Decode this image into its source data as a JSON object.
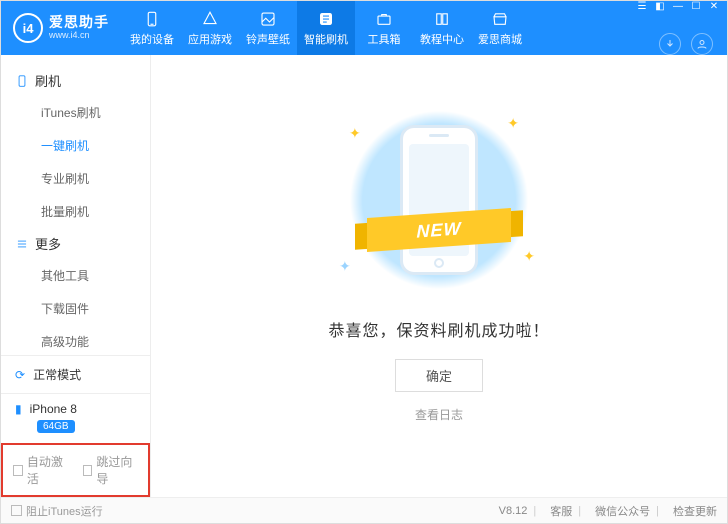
{
  "brand": {
    "logo_text": "i4",
    "title": "爱思助手",
    "url": "www.i4.cn"
  },
  "top_tabs": [
    {
      "label": "我的设备"
    },
    {
      "label": "应用游戏"
    },
    {
      "label": "铃声壁纸"
    },
    {
      "label": "智能刷机"
    },
    {
      "label": "工具箱"
    },
    {
      "label": "教程中心"
    },
    {
      "label": "爱思商城"
    }
  ],
  "sidebar": {
    "sections": [
      {
        "header": "刷机",
        "items": [
          "iTunes刷机",
          "一键刷机",
          "专业刷机",
          "批量刷机"
        ]
      },
      {
        "header": "更多",
        "items": [
          "其他工具",
          "下载固件",
          "高级功能"
        ]
      }
    ],
    "status": "正常模式",
    "device": {
      "name": "iPhone 8",
      "storage": "64GB"
    },
    "options": {
      "auto_activate": "自动激活",
      "skip_guide": "跳过向导"
    }
  },
  "main": {
    "ribbon_text": "NEW",
    "success_text": "恭喜您，保资料刷机成功啦！",
    "ok_button": "确定",
    "log_link": "查看日志"
  },
  "footer": {
    "block_itunes": "阻止iTunes运行",
    "version": "V8.12",
    "support": "客服",
    "wechat": "微信公众号",
    "check_update": "检查更新"
  }
}
